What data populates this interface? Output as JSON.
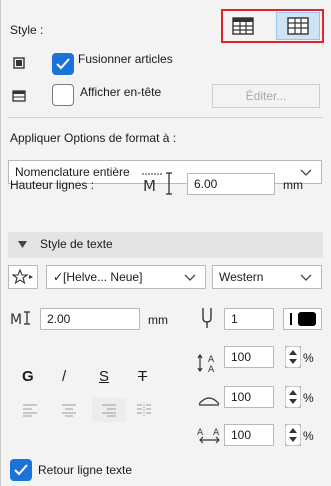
{
  "style_label": "Style :",
  "view_toggle": {
    "left_selected": false,
    "right_selected": true,
    "highlight_color": "#e0232c"
  },
  "merge": {
    "label": "Fusionner articles",
    "checked": true
  },
  "header": {
    "label": "Afficher en-tête",
    "checked": false,
    "edit_label": "Éditer..."
  },
  "apply_format": {
    "label": "Appliquer Options de format à :",
    "selected": "Nomenclature entière"
  },
  "row_height": {
    "label": "Hauteur lignes :",
    "value": "6.00",
    "unit": "mm"
  },
  "text_style": {
    "section_label": "Style de texte",
    "font": "✓[Helve... Neue]",
    "encoding": "Western",
    "size_value": "2.00",
    "size_unit": "mm",
    "pen_value": "1",
    "width_value": "100",
    "spacing_value": "100",
    "char_spacing_value": "100",
    "percent": "%",
    "bold_glyph": "G",
    "italic_glyph": "/",
    "underline_glyph": "S",
    "strike_glyph": "T"
  },
  "wrap": {
    "label": "Retour ligne texte",
    "checked": true
  },
  "colors": {
    "accent": "#1a73d9",
    "pen_swatch": "#000000"
  }
}
